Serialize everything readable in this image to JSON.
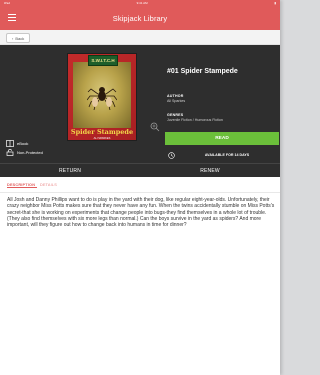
{
  "app": {
    "title": "Skipjack Library"
  },
  "statusbar": {
    "carrier": "iPad",
    "time": "9:41 AM"
  },
  "toolbar": {
    "back_label": "Back"
  },
  "book": {
    "title": "#01 Spider Stampede",
    "author_label": "AUTHOR",
    "author": "Ali Sparkes",
    "genres_label": "GENRES",
    "genres": "Juvenile Fiction / Humorous Fiction",
    "cover": {
      "series_mark": "S.W.I.T.C.H",
      "title": "Spider Stampede",
      "author": "ALI SPARKES"
    }
  },
  "actions": {
    "read_label": "READ",
    "availability": "AVAILABLE FOR 14 DAYS",
    "return_label": "RETURN",
    "renew_label": "RENEW"
  },
  "info": {
    "format": "eBook",
    "protection": "Non-Protected"
  },
  "tabs": [
    {
      "label": "DESCRIPTION"
    },
    {
      "label": "DETAILS"
    }
  ],
  "description": "All Josh and Danny Phillips want to do is play in the yard with their dog, like regular eight-year-olds. Unfortunately, their crazy neighbor Miss Potts makes sure that they never have any fun. When the twins accidentally stumble on Miss Potts's secret-that she is working on experiments that change people into bugs-they find themselves in a whole lot of trouble. (They also find themselves with six more legs than normal.) Can the boys survive in the yard as spiders? And more important, will they figure out how to change back into humans in time for dinner?",
  "colors": {
    "accent": "#e05a5a",
    "read_button": "#6bbf3a",
    "detail_panel": "#2e2e2e"
  }
}
